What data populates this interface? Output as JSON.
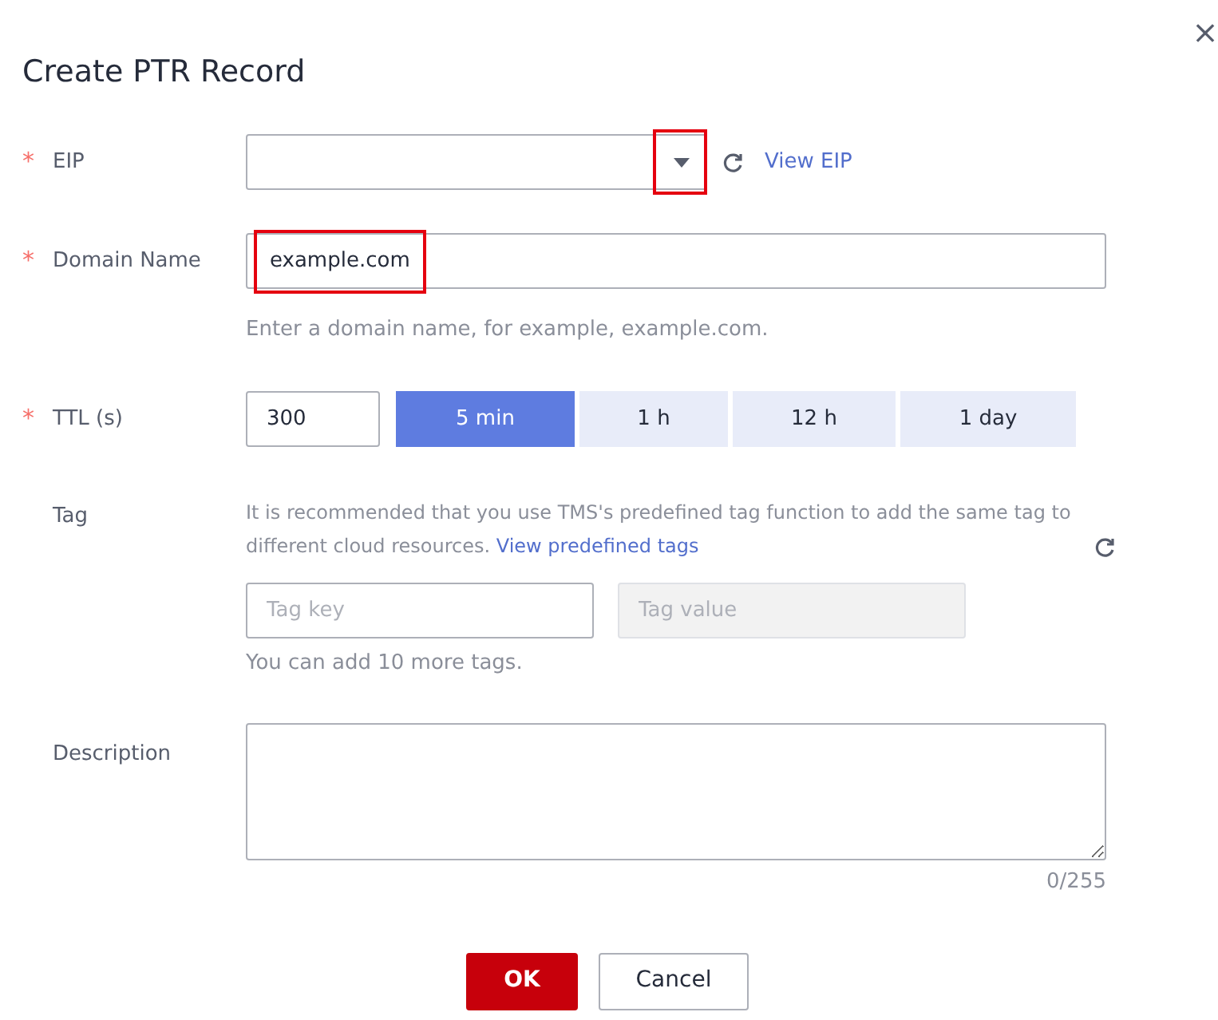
{
  "dialog": {
    "title": "Create PTR Record",
    "close": "×"
  },
  "eip": {
    "label": "EIP",
    "required_mark": "*",
    "arrow_highlighted": true,
    "link": "View EIP"
  },
  "domain": {
    "label": "Domain Name",
    "required_mark": "*",
    "value": "example.com",
    "value_highlighted": true,
    "hint": "Enter a domain name, for example, example.com."
  },
  "ttl": {
    "label": "TTL (s)",
    "required_mark": "*",
    "value": "300",
    "options": [
      {
        "label": "5 min",
        "selected": true
      },
      {
        "label": "1 h",
        "selected": false
      },
      {
        "label": "12 h",
        "selected": false
      },
      {
        "label": "1 day",
        "selected": false
      }
    ]
  },
  "tag": {
    "label": "Tag",
    "note": "It is recommended that you use TMS's predefined tag function to add the same tag to different cloud resources.",
    "link": "View predefined tags",
    "key_placeholder": "Tag key",
    "value_placeholder": "Tag value",
    "value_disabled": true,
    "hint": "You can add 10 more tags."
  },
  "description": {
    "label": "Description",
    "counter": "0/255"
  },
  "buttons": [
    {
      "label": "OK",
      "kind": "primary"
    },
    {
      "label": "Cancel",
      "kind": "secondary"
    }
  ]
}
